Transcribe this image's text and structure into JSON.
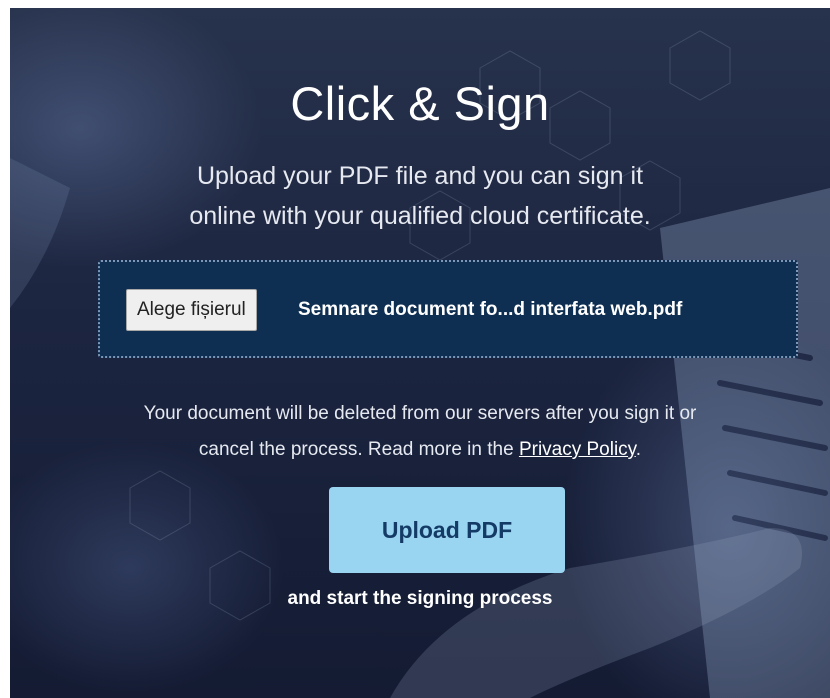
{
  "hero": {
    "title": "Click & Sign",
    "subtitle_line1": "Upload your PDF file and you can sign it",
    "subtitle_line2": "online with your qualified cloud certificate."
  },
  "file_input": {
    "button_label": "Alege fișierul",
    "selected_file": "Semnare document fo...d interfata web.pdf"
  },
  "notice": {
    "line1": "Your document will be deleted from our servers after you sign it or",
    "line2_prefix": "cancel the process. Read more in the ",
    "privacy_link": "Privacy Policy",
    "line2_suffix": "."
  },
  "upload": {
    "button_label": "Upload PDF",
    "caption": "and start the signing process"
  },
  "colors": {
    "background": "#1c2540",
    "dropzone": "#0f2f52",
    "upload_button": "#99d4f1",
    "upload_text": "#143a66"
  }
}
